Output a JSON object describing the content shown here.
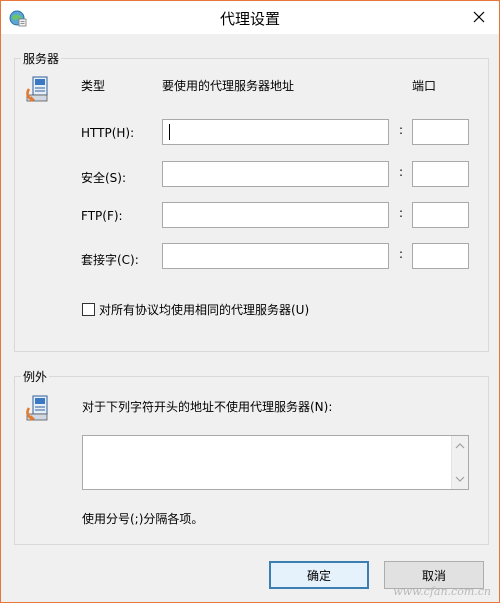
{
  "window": {
    "title": "代理设置"
  },
  "servers": {
    "group_label": "服务器",
    "header_type": "类型",
    "header_address": "要使用的代理服务器地址",
    "header_port": "端口",
    "rows": [
      {
        "label": "HTTP(H):",
        "address": "",
        "port": ""
      },
      {
        "label": "安全(S):",
        "address": "",
        "port": ""
      },
      {
        "label": "FTP(F):",
        "address": "",
        "port": ""
      },
      {
        "label": "套接字(C):",
        "address": "",
        "port": ""
      }
    ],
    "colon": ":",
    "same_proxy_checkbox": {
      "label": "对所有协议均使用相同的代理服务器(U)",
      "checked": false
    }
  },
  "exceptions": {
    "group_label": "例外",
    "description": "对于下列字符开头的地址不使用代理服务器(N):",
    "value": "",
    "hint": "使用分号(;)分隔各项。"
  },
  "buttons": {
    "ok": "确定",
    "cancel": "取消"
  },
  "watermark": "www.cfan.com.cn"
}
